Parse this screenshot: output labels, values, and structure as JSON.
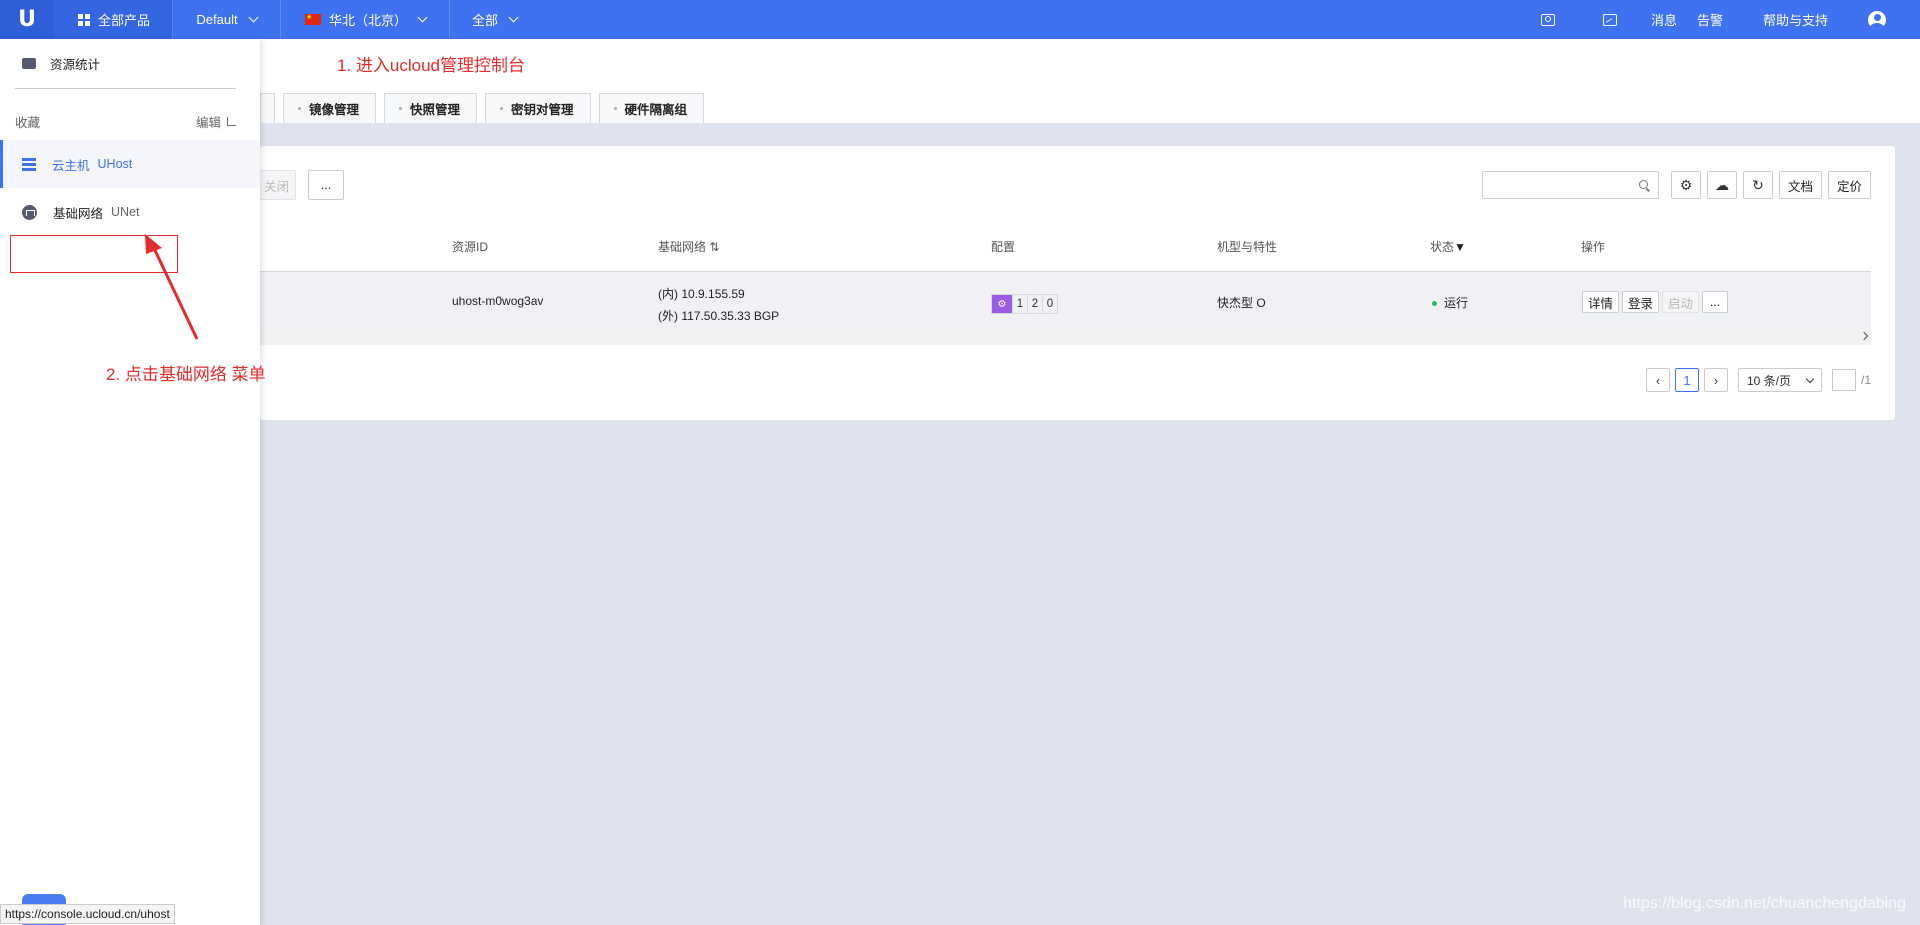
{
  "topbar": {
    "logo": "U",
    "products": "全部产品",
    "project": "Default",
    "region": "华北（北京）",
    "scope": "全部",
    "messages": "消息",
    "alerts": "告警",
    "help": "帮助与支持"
  },
  "annotations": {
    "step1": "1. 进入ucloud管理控制台",
    "step2": "2. 点击基础网络 菜单"
  },
  "tabs": [
    "镜像管理",
    "快照管理",
    "密钥对管理",
    "硬件隔离组"
  ],
  "toolbar": {
    "close_label": "关闭",
    "more_label": "...",
    "search_placeholder": "",
    "docs_label": "文档",
    "pricing_label": "定价"
  },
  "table": {
    "columns": [
      "资源ID",
      "基础网络",
      "配置",
      "机型与特性",
      "状态",
      "操作"
    ],
    "rows": [
      {
        "id": "uhost-m0wog3av",
        "ip_inner": "(内) 10.9.155.59",
        "ip_outer": "(外) 117.50.35.33 BGP",
        "spec": [
          "1",
          "2",
          "0"
        ],
        "type": "快杰型 O",
        "status": "运行",
        "actions": [
          "详情",
          "登录",
          "启动",
          "..."
        ]
      }
    ]
  },
  "pagination": {
    "current": "1",
    "page_size": "10 条/页",
    "total": "/1"
  },
  "sidebar": {
    "stats": "资源统计",
    "favorites": "收藏",
    "edit": "编辑",
    "items": [
      {
        "label": "云主机",
        "sub": "UHost"
      },
      {
        "label": "基础网络",
        "sub": "UNet"
      }
    ]
  },
  "statusbar": "https://console.ucloud.cn/uhost",
  "watermark": "https://blog.csdn.net/chuanchengdabing",
  "colors": {
    "accent": "#3e72f0",
    "annotation": "#e52b2b",
    "status_running": "#2db55d"
  }
}
